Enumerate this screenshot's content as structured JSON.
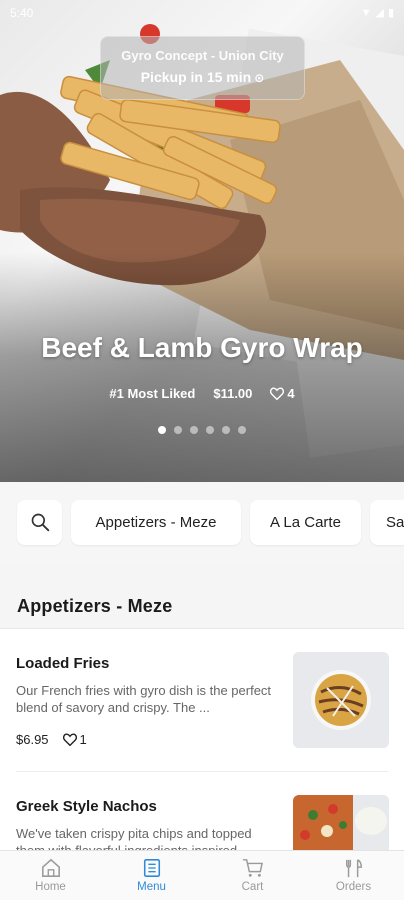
{
  "status_bar": {
    "time": "5:40"
  },
  "pickup": {
    "location": "Gyro Concept - Union City",
    "time": "Pickup in 15 min",
    "clock_icon": "clock-icon"
  },
  "hero": {
    "title": "Beef & Lamb Gyro Wrap",
    "badge": "#1 Most Liked",
    "price": "$11.00",
    "likes": "4",
    "slides_total": 6,
    "slide_active": 1
  },
  "categories": {
    "search_icon": "search-icon",
    "items": [
      "Appetizers - Meze",
      "A La Carte",
      "Sa"
    ]
  },
  "section": {
    "title": "Appetizers - Meze"
  },
  "menu_items": [
    {
      "name": "Loaded Fries",
      "desc": "Our French fries with gyro dish is the perfect blend of savory and crispy. The ...",
      "price": "$6.95",
      "likes": "1"
    },
    {
      "name": "Greek Style Nachos",
      "desc": "We've taken crispy pita chips and topped them with flavorful ingredients inspired",
      "price": "",
      "likes": ""
    }
  ],
  "nav": {
    "home": "Home",
    "menu": "Menu",
    "cart": "Cart",
    "orders": "Orders",
    "active": "Menu"
  },
  "colors": {
    "accent": "#2f8ad8",
    "inactive": "#9a9a9a"
  }
}
